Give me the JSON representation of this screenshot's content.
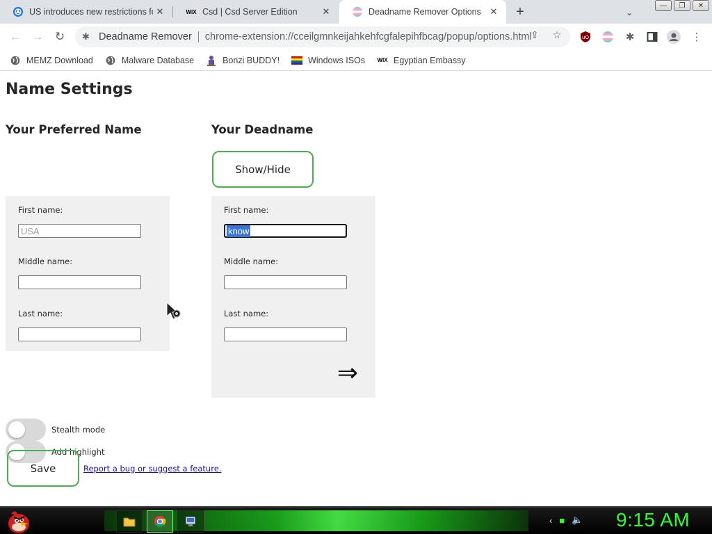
{
  "tabs": [
    {
      "title": "US introduces new restrictions fo",
      "icon": "globe-blue-icon"
    },
    {
      "title": "Csd | Csd Server Edition",
      "icon": "wix-icon"
    },
    {
      "title": "Deadname Remover Options",
      "icon": "trans-flag-icon",
      "active": true
    }
  ],
  "omnibox": {
    "site_name": "Deadname Remover",
    "url": "chrome-extension://cceilgmnkeijahkehfcgfalepihfbcag/popup/options.html"
  },
  "bookmarks": [
    {
      "label": "MEMZ Download",
      "icon": "globe-icon"
    },
    {
      "label": "Malware Database",
      "icon": "globe-icon"
    },
    {
      "label": "Bonzi BUDDY!",
      "icon": "bonzi-icon"
    },
    {
      "label": "Windows ISOs",
      "icon": "rainbow-flag-icon"
    },
    {
      "label": "Egyptian Embassy",
      "icon": "wix-icon"
    }
  ],
  "page": {
    "title": "Name Settings",
    "preferred_heading": "Your Preferred Name",
    "deadname_heading": "Your Deadname",
    "show_hide": "Show/Hide",
    "preferred": {
      "first_label": "First name:",
      "first_placeholder": "USA",
      "middle_label": "Middle name:",
      "last_label": "Last name:"
    },
    "deadname": {
      "first_label": "First name:",
      "first_value": "know",
      "middle_label": "Middle name:",
      "last_label": "Last name:"
    },
    "arrow": "⇒",
    "stealth_label": "Stealth mode",
    "highlight_label": "Add highlight",
    "save_label": "Save",
    "report_link": "Report a bug or suggest a feature."
  },
  "taskbar": {
    "clock": "9:15 AM"
  },
  "colors": {
    "accent_green": "#4caf50",
    "selection": "#3875d7",
    "clock_green": "#2aff2a"
  }
}
